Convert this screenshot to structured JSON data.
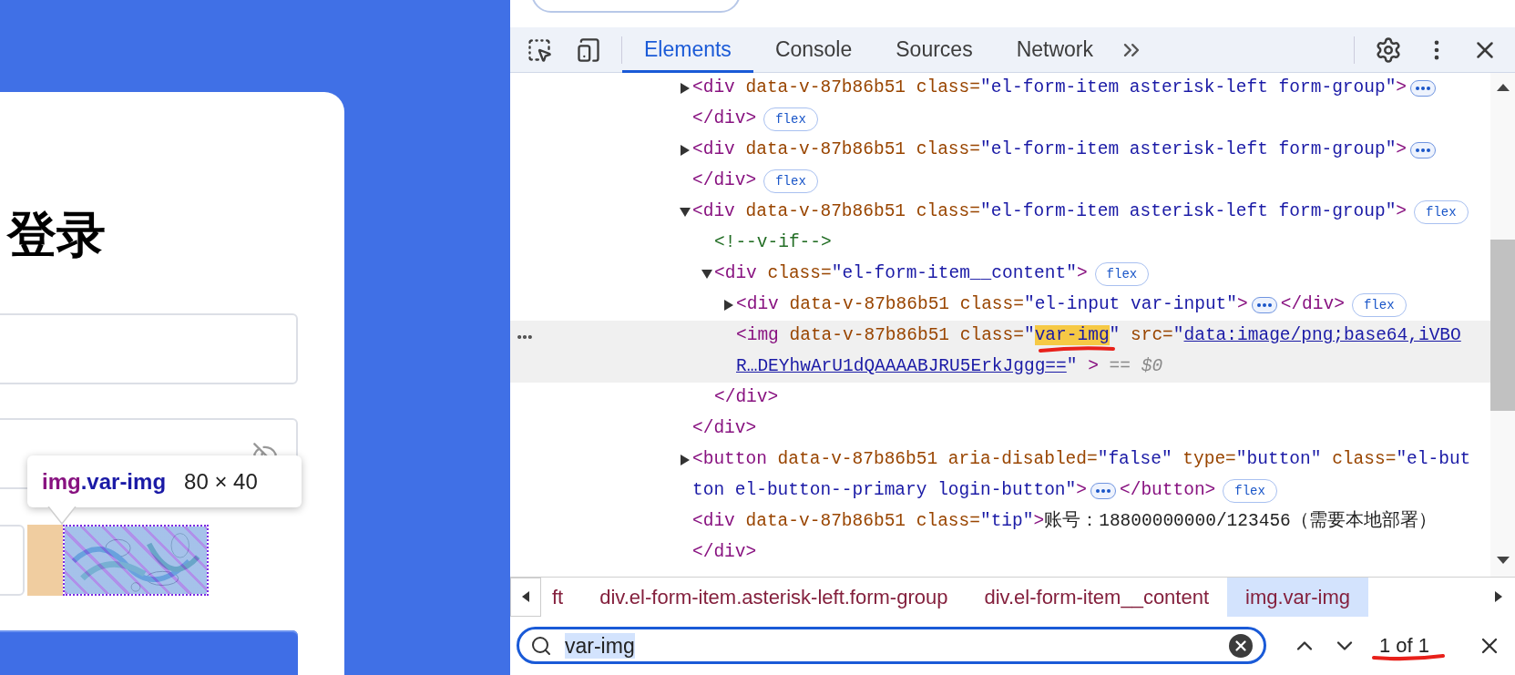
{
  "page": {
    "title": "登录",
    "tooltip": {
      "tag": "img",
      "class_name": ".var-img",
      "size": "80 × 40"
    }
  },
  "devtools": {
    "tabs": [
      {
        "label": "Elements",
        "selected": true
      },
      {
        "label": "Console",
        "selected": false
      },
      {
        "label": "Sources",
        "selected": false
      },
      {
        "label": "Network",
        "selected": false
      }
    ],
    "tree": [
      {
        "expanded": false,
        "selected": false,
        "lines": [
          [
            {
              "kind": "tag",
              "s": "<div"
            },
            {
              "kind": "attr",
              "s": " data-v-87b86b51"
            },
            {
              "kind": "attr",
              "s": " class="
            },
            {
              "kind": "val",
              "s": "\"el-form-item asterisk-left form-group\""
            },
            {
              "kind": "tag",
              "s": ">"
            },
            {
              "kind": "more"
            }
          ],
          [
            {
              "kind": "tag",
              "s": "</div>"
            },
            {
              "kind": "badge",
              "s": "flex"
            }
          ]
        ]
      },
      {
        "expanded": false,
        "selected": false,
        "lines": [
          [
            {
              "kind": "tag",
              "s": "<div"
            },
            {
              "kind": "attr",
              "s": " data-v-87b86b51"
            },
            {
              "kind": "attr",
              "s": " class="
            },
            {
              "kind": "val",
              "s": "\"el-form-item asterisk-left form-group\""
            },
            {
              "kind": "tag",
              "s": ">"
            },
            {
              "kind": "more"
            }
          ],
          [
            {
              "kind": "tag",
              "s": "</div>"
            },
            {
              "kind": "badge",
              "s": "flex"
            }
          ]
        ]
      },
      {
        "expanded": true,
        "selected": false,
        "lines": [
          [
            {
              "kind": "tag",
              "s": "<div"
            },
            {
              "kind": "attr",
              "s": " data-v-87b86b51"
            },
            {
              "kind": "attr",
              "s": " class="
            },
            {
              "kind": "val",
              "s": "\"el-form-item asterisk-left form-group\""
            },
            {
              "kind": "tag",
              "s": ">"
            },
            {
              "kind": "badge",
              "s": "flex"
            }
          ]
        ],
        "close": [
          {
            "kind": "tag",
            "s": "</div>"
          }
        ],
        "children": [
          {
            "selected": false,
            "lines": [
              [
                {
                  "kind": "comment",
                  "s": "<!--v-if-->"
                }
              ]
            ]
          },
          {
            "expanded": true,
            "selected": false,
            "lines": [
              [
                {
                  "kind": "tag",
                  "s": "<div"
                },
                {
                  "kind": "attr",
                  "s": " class="
                },
                {
                  "kind": "val",
                  "s": "\"el-form-item__content\""
                },
                {
                  "kind": "tag",
                  "s": ">"
                },
                {
                  "kind": "badge",
                  "s": "flex"
                }
              ]
            ],
            "close": [
              {
                "kind": "tag",
                "s": "</div>"
              }
            ],
            "children": [
              {
                "expanded": false,
                "selected": false,
                "lines": [
                  [
                    {
                      "kind": "tag",
                      "s": "<div"
                    },
                    {
                      "kind": "attr",
                      "s": " data-v-87b86b51"
                    },
                    {
                      "kind": "attr",
                      "s": " class="
                    },
                    {
                      "kind": "val",
                      "s": "\"el-input var-input\""
                    },
                    {
                      "kind": "tag",
                      "s": ">"
                    },
                    {
                      "kind": "more"
                    },
                    {
                      "kind": "tag",
                      "s": "</div>"
                    },
                    {
                      "kind": "badge",
                      "s": "flex"
                    }
                  ]
                ]
              },
              {
                "selected": true,
                "lines": [
                  [
                    {
                      "kind": "tag",
                      "s": "<img"
                    },
                    {
                      "kind": "attr",
                      "s": " data-v-87b86b51"
                    },
                    {
                      "kind": "attr",
                      "s": " class="
                    },
                    {
                      "kind": "val",
                      "s": "\""
                    },
                    {
                      "kind": "match",
                      "s": "var-img"
                    },
                    {
                      "kind": "val",
                      "s": "\""
                    },
                    {
                      "kind": "attr",
                      "s": " src="
                    },
                    {
                      "kind": "val",
                      "s": "\""
                    },
                    {
                      "kind": "link",
                      "s": "data:image/png;base64,iVBO"
                    }
                  ],
                  [
                    {
                      "kind": "link",
                      "s": "R…DEYhwArU1dQAAAABJRU5ErkJggg=="
                    },
                    {
                      "kind": "val",
                      "s": "\""
                    },
                    {
                      "kind": "tag",
                      "s": " >"
                    },
                    {
                      "kind": "ref",
                      "s": " == $0"
                    }
                  ]
                ]
              }
            ]
          }
        ]
      },
      {
        "expanded": false,
        "selected": false,
        "lines": [
          [
            {
              "kind": "tag",
              "s": "<button"
            },
            {
              "kind": "attr",
              "s": " data-v-87b86b51"
            },
            {
              "kind": "attr",
              "s": " aria-disabled="
            },
            {
              "kind": "val",
              "s": "\"false\""
            },
            {
              "kind": "attr",
              "s": " type="
            },
            {
              "kind": "val",
              "s": "\"button\""
            },
            {
              "kind": "attr",
              "s": " class="
            },
            {
              "kind": "val",
              "s": "\"el-but"
            }
          ],
          [
            {
              "kind": "val",
              "s": "ton el-button--primary login-button\""
            },
            {
              "kind": "tag",
              "s": ">"
            },
            {
              "kind": "more"
            },
            {
              "kind": "tag",
              "s": "</button>"
            },
            {
              "kind": "badge",
              "s": "flex"
            }
          ]
        ]
      },
      {
        "selected": false,
        "lines": [
          [
            {
              "kind": "tag",
              "s": "<div"
            },
            {
              "kind": "attr",
              "s": " data-v-87b86b51"
            },
            {
              "kind": "attr",
              "s": " class="
            },
            {
              "kind": "val",
              "s": "\"tip\""
            },
            {
              "kind": "tag",
              "s": ">"
            },
            {
              "kind": "text",
              "s": "账号：18800000000/123456（需要本地部署）"
            }
          ],
          [
            {
              "kind": "tag",
              "s": "</div>"
            }
          ]
        ]
      }
    ],
    "breadcrumbs": [
      {
        "label": "ft",
        "selected": false
      },
      {
        "label": "div.el-form-item.asterisk-left.form-group",
        "selected": false
      },
      {
        "label": "div.el-form-item__content",
        "selected": false
      },
      {
        "label": "img.var-img",
        "selected": true
      }
    ],
    "search": {
      "value": "var-img",
      "count": "1 of 1"
    }
  }
}
